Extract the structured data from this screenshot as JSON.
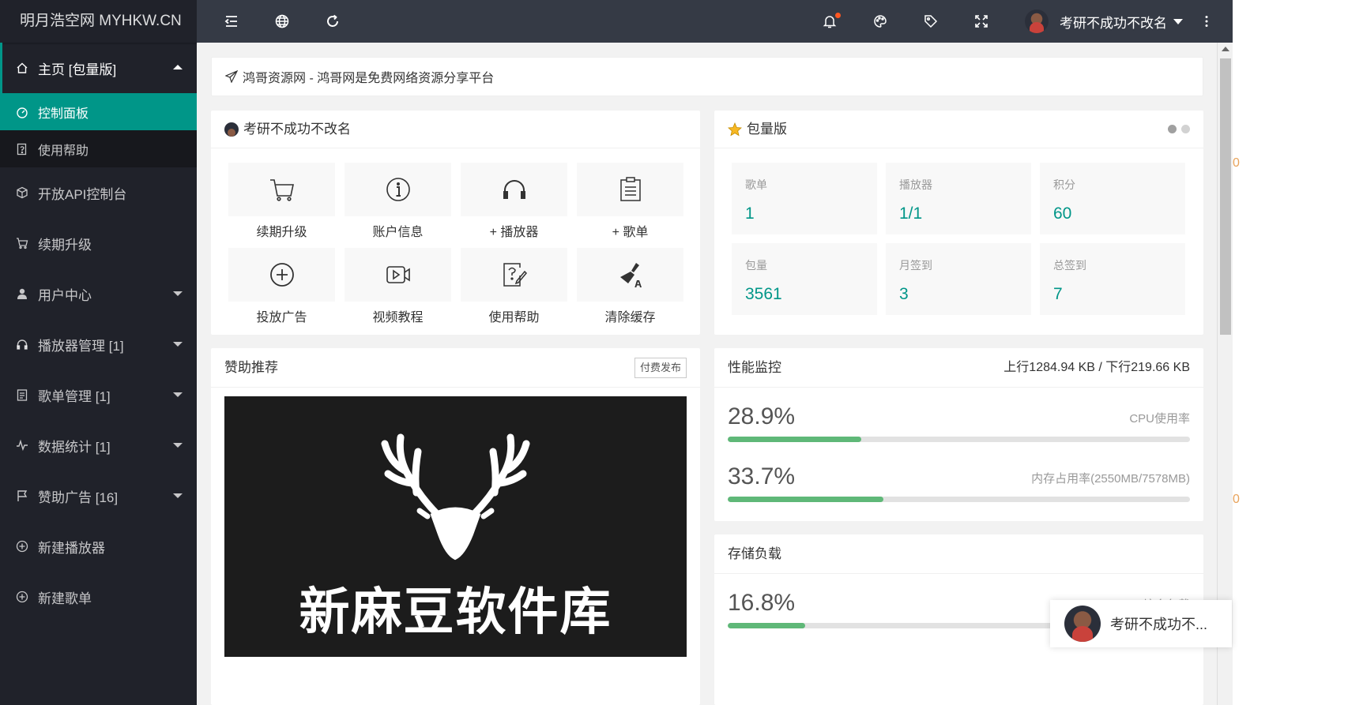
{
  "sidebar": {
    "logo": "明月浩空网 MYHKW.CN",
    "home": "主页 [包量版]",
    "home_sub": [
      {
        "label": "控制面板",
        "icon": "dashboard-icon"
      },
      {
        "label": "使用帮助",
        "icon": "help-doc-icon"
      }
    ],
    "items": [
      {
        "label": "开放API控制台",
        "icon": "cube-icon"
      },
      {
        "label": "续期升级",
        "icon": "cart-icon"
      },
      {
        "label": "用户中心",
        "icon": "user-icon"
      },
      {
        "label": "播放器管理 [1]",
        "icon": "headphones-icon"
      },
      {
        "label": "歌单管理 [1]",
        "icon": "list-icon"
      },
      {
        "label": "数据统计 [1]",
        "icon": "pulse-icon"
      },
      {
        "label": "赞助广告 [16]",
        "icon": "flag-icon"
      },
      {
        "label": "新建播放器",
        "icon": "plus-circle-icon"
      },
      {
        "label": "新建歌单",
        "icon": "plus-circle-icon"
      }
    ]
  },
  "topbar": {
    "username": "考研不成功不改名"
  },
  "notice": "鸿哥资源网 - 鸿哥网是免费网络资源分享平台",
  "profile_card": {
    "title": "考研不成功不改名",
    "shortcuts": [
      {
        "label": "续期升级",
        "icon": "cart-icon"
      },
      {
        "label": "账户信息",
        "icon": "info-icon"
      },
      {
        "label": "+ 播放器",
        "icon": "headphones-icon"
      },
      {
        "label": "+ 歌单",
        "icon": "clipboard-icon"
      },
      {
        "label": "投放广告",
        "icon": "plus-circle-icon"
      },
      {
        "label": "视频教程",
        "icon": "video-icon"
      },
      {
        "label": "使用帮助",
        "icon": "help-edit-icon"
      },
      {
        "label": "清除缓存",
        "icon": "broom-icon"
      }
    ]
  },
  "package_card": {
    "title": "包量版",
    "stats": [
      {
        "label": "歌单",
        "value": "1"
      },
      {
        "label": "播放器",
        "value": "1/1"
      },
      {
        "label": "积分",
        "value": "60"
      },
      {
        "label": "包量",
        "value": "3561"
      },
      {
        "label": "月签到",
        "value": "3"
      },
      {
        "label": "总签到",
        "value": "7"
      }
    ]
  },
  "sponsor_card": {
    "title": "赞助推荐",
    "button": "付费发布",
    "ad_text": "新麻豆软件库"
  },
  "perf_card": {
    "title": "性能监控",
    "traffic": "上行1284.94 KB / 下行219.66 KB",
    "meters": [
      {
        "percent_text": "28.9%",
        "label": "CPU使用率",
        "value": 28.9
      },
      {
        "percent_text": "33.7%",
        "label": "内存占用率(2550MB/7578MB)",
        "value": 33.7
      }
    ]
  },
  "storage_card": {
    "title": "存储负载",
    "meters": [
      {
        "percent_text": "16.8%",
        "label": "综合负载",
        "value": 16.8
      }
    ]
  },
  "chat_popup": {
    "text": "考研不成功不..."
  },
  "right_fragments": [
    "0",
    "0"
  ],
  "colors": {
    "accent": "#009688",
    "sidebar_bg": "#20222a",
    "topbar_bg": "#353a45",
    "progress": "#5fb878",
    "badge": "#ff5722"
  }
}
